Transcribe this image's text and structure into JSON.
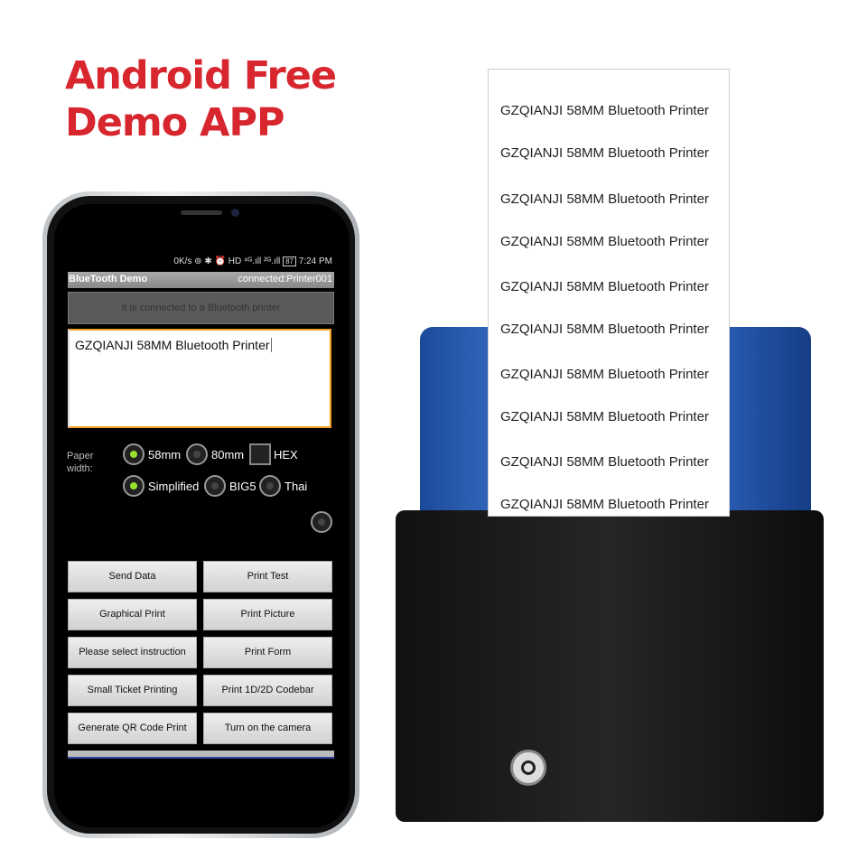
{
  "headline": {
    "line1": "Android Free",
    "line2": "Demo APP"
  },
  "status_bar": {
    "text": "0K/s ⊚ ✱ ⏰ HD ⁴ᴳ.ıll ²ᴳ.ıll",
    "battery": "87",
    "time": "7:24 PM"
  },
  "app": {
    "title": "BlueTooth Demo",
    "connection": "connected:Printer001",
    "connected_message": "It is connected to a Bluetooth printer",
    "input_value": "GZQIANJI 58MM Bluetooth Printer",
    "paper_width_label": "Paper width:",
    "options": {
      "w58": "58mm",
      "w80": "80mm",
      "hex": "HEX",
      "simplified": "Simplified",
      "big5": "BIG5",
      "thai": "Thai"
    },
    "selected": {
      "paper_width": "58mm",
      "encoding": "Simplified",
      "hex": false
    },
    "buttons": [
      "Send Data",
      "Print Test",
      "Graphical Print",
      "Print Picture",
      "Please select instruction",
      "Print Form",
      "Small Ticket Printing",
      "Print 1D/2D Codebar",
      "Generate QR Code Print",
      "Turn on the camera"
    ]
  },
  "printout": {
    "lines": [
      "GZQIANJI 58MM Bluetooth Printer",
      "GZQIANJI 58MM Bluetooth Printer",
      "GZQIANJI 58MM Bluetooth Printer",
      "GZQIANJI 58MM Bluetooth Printer",
      "GZQIANJI 58MM Bluetooth Printer",
      "GZQIANJI 58MM Bluetooth Printer",
      "GZQIANJI 58MM Bluetooth Printer",
      "GZQIANJI 58MM Bluetooth Printer",
      "GZQIANJI 58MM Bluetooth Printer",
      "GZQIANJI 58MM Bluetooth Printer"
    ]
  },
  "colors": {
    "headline": "#d7262e",
    "radio_on": "#9be22d",
    "printer_top": "#2e65c0"
  }
}
